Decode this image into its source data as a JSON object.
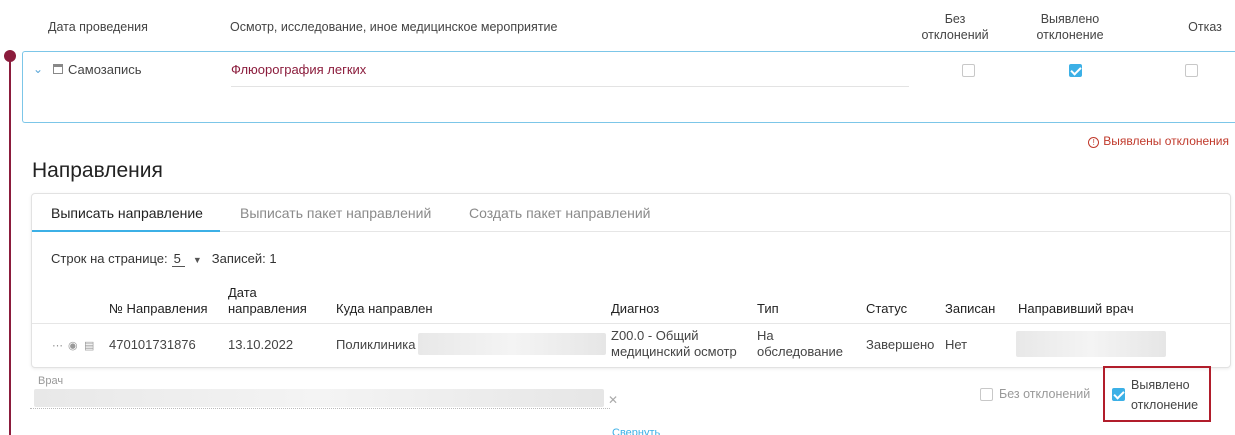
{
  "exam_table": {
    "headers": {
      "date": "Дата проведения",
      "exam": "Осмотр, исследование, иное медицинское мероприятие",
      "no_deviation": "Без отклонений",
      "deviation": "Выявлено отклонение",
      "refusal": "Отказ"
    },
    "row": {
      "type": "Самозапись",
      "exam_name": "Флюорография легких",
      "no_deviation": false,
      "deviation": true,
      "refusal": false
    }
  },
  "warning": "Выявлены отклонения",
  "section_title": "Направления",
  "tabs": [
    "Выписать направление",
    "Выписать пакет направлений",
    "Создать пакет направлений"
  ],
  "pager": {
    "rows_label": "Строк на странице:",
    "rows_value": "5",
    "records_label": "Записей: 1"
  },
  "referrals_table": {
    "columns": [
      "№ Направления",
      "Дата направления",
      "Куда направлен",
      "Диагноз",
      "Тип",
      "Статус",
      "Записан",
      "Направивший врач"
    ],
    "rows": [
      {
        "number": "470101731876",
        "date": "13.10.2022",
        "destination": "Поликлиника",
        "diagnosis": "Z00.0 - Общий медицинский осмотр",
        "type": "На обследование",
        "status": "Завершено",
        "registered": "Нет"
      }
    ]
  },
  "doctor_field": {
    "label": "Врач",
    "value": ""
  },
  "result_options": {
    "no_deviation": "Без отклонений",
    "deviation": "Выявлено отклонение",
    "no_deviation_checked": false,
    "deviation_checked": true
  },
  "collapse_link": "Свернуть",
  "colors": {
    "accent": "#3cb0e6",
    "brand": "#8b1c3c",
    "error": "#c0392b"
  }
}
